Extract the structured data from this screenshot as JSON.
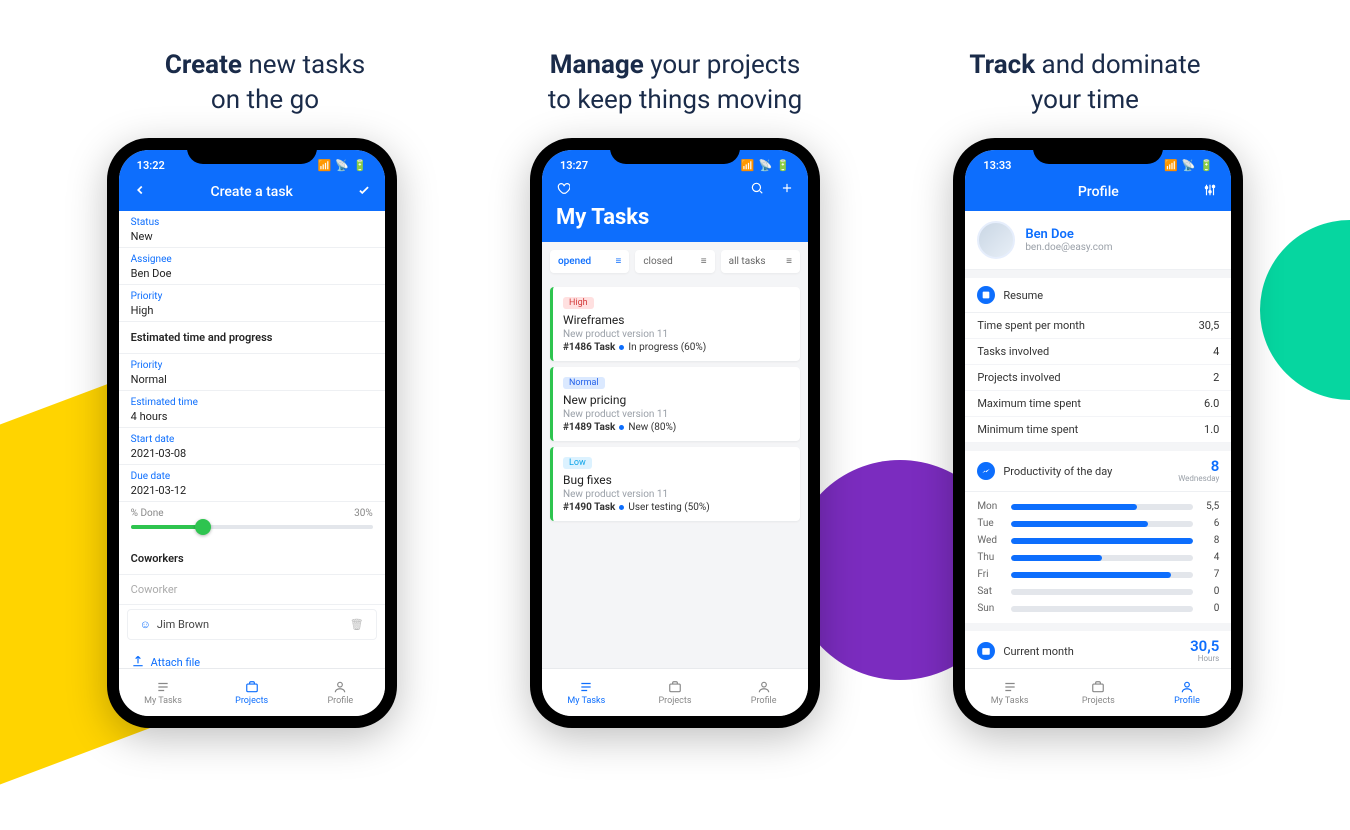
{
  "headlines": {
    "create": {
      "bold": "Create",
      "rest": " new tasks\non the go"
    },
    "manage": {
      "bold": "Manage",
      "rest": " your projects\nto keep things moving"
    },
    "track": {
      "bold": "Track",
      "rest": " and dominate\nyour time"
    }
  },
  "phone1": {
    "time": "13:22",
    "header_title": "Create a task",
    "fields": {
      "status": {
        "label": "Status",
        "value": "New"
      },
      "assignee": {
        "label": "Assignee",
        "value": "Ben Doe"
      },
      "priority": {
        "label": "Priority",
        "value": "High"
      },
      "section1": "Estimated time and progress",
      "priority2": {
        "label": "Priority",
        "value": "Normal"
      },
      "est_time": {
        "label": "Estimated time",
        "value": "4 hours"
      },
      "start": {
        "label": "Start date",
        "value": "2021-03-08"
      },
      "due": {
        "label": "Due date",
        "value": "2021-03-12"
      },
      "done_label": "% Done",
      "done_value": "30%",
      "section2": "Coworkers",
      "coworker_placeholder": "Coworker",
      "coworker_chip": "Jim Brown",
      "attach": "Attach file"
    },
    "nav": {
      "tasks": "My Tasks",
      "projects": "Projects",
      "profile": "Profile",
      "active": "projects"
    }
  },
  "phone2": {
    "time": "13:27",
    "title": "My Tasks",
    "tabs": {
      "opened": "opened",
      "closed": "closed",
      "all": "all tasks",
      "active": "opened"
    },
    "tasks": [
      {
        "prio": "High",
        "prio_cls": "high",
        "title": "Wireframes",
        "project": "New product version 11",
        "id": "#1486 Task",
        "status": "In progress (60%)"
      },
      {
        "prio": "Normal",
        "prio_cls": "normal",
        "title": "New pricing",
        "project": "New product version 11",
        "id": "#1489 Task",
        "status": "New (80%)"
      },
      {
        "prio": "Low",
        "prio_cls": "low",
        "title": "Bug fixes",
        "project": "New product version 11",
        "id": "#1490 Task",
        "status": "User testing (50%)"
      }
    ],
    "nav": {
      "tasks": "My Tasks",
      "projects": "Projects",
      "profile": "Profile",
      "active": "tasks"
    }
  },
  "phone3": {
    "time": "13:33",
    "header_title": "Profile",
    "user": {
      "name": "Ben Doe",
      "email": "ben.doe@easy.com"
    },
    "resume_title": "Resume",
    "resume": [
      {
        "k": "Time spent per month",
        "v": "30,5"
      },
      {
        "k": "Tasks involved",
        "v": "4"
      },
      {
        "k": "Projects involved",
        "v": "2"
      },
      {
        "k": "Maximum time spent",
        "v": "6.0"
      },
      {
        "k": "Minimum time spent",
        "v": "1.0"
      }
    ],
    "productivity": {
      "title": "Productivity of the day",
      "value": "8",
      "value_sub": "Wednesday",
      "rows": [
        {
          "day": "Mon",
          "v": 5.5,
          "disp": "5,5"
        },
        {
          "day": "Tue",
          "v": 6,
          "disp": "6"
        },
        {
          "day": "Wed",
          "v": 8,
          "disp": "8"
        },
        {
          "day": "Thu",
          "v": 4,
          "disp": "4"
        },
        {
          "day": "Fri",
          "v": 7,
          "disp": "7"
        },
        {
          "day": "Sat",
          "v": 0,
          "disp": "0"
        },
        {
          "day": "Sun",
          "v": 0,
          "disp": "0"
        }
      ],
      "max": 8
    },
    "current_month": {
      "title": "Current month",
      "value": "30,5",
      "value_sub": "Hours"
    },
    "nav": {
      "tasks": "My Tasks",
      "projects": "Projects",
      "profile": "Profile",
      "active": "profile"
    }
  },
  "chart_data": {
    "type": "bar",
    "title": "Productivity of the day",
    "categories": [
      "Mon",
      "Tue",
      "Wed",
      "Thu",
      "Fri",
      "Sat",
      "Sun"
    ],
    "values": [
      5.5,
      6,
      8,
      4,
      7,
      0,
      0
    ],
    "ylim": [
      0,
      8
    ]
  }
}
